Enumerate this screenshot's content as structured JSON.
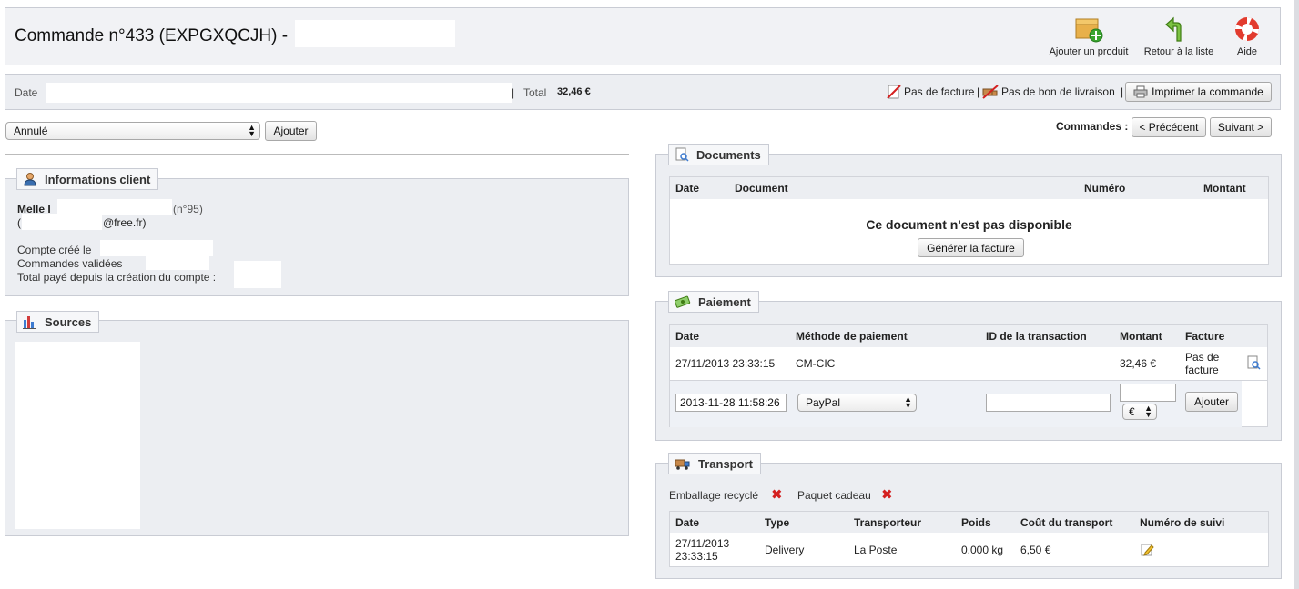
{
  "header": {
    "title": "Commande n°433 (EXPGXQCJH) -",
    "toolbar": {
      "add_product": "Ajouter un produit",
      "back_to_list": "Retour à la liste",
      "help": "Aide"
    }
  },
  "info_bar": {
    "date_label": "Date",
    "separator": "|",
    "total_label": "Total",
    "total_value": "32,46 €",
    "no_invoice": "Pas de facture",
    "pipe": "|",
    "no_delivery_slip": "Pas de bon de livraison",
    "print_order": "Imprimer la commande"
  },
  "status": {
    "selected": "Annulé",
    "add_button": "Ajouter"
  },
  "order_nav": {
    "label": "Commandes :",
    "previous": "< Précédent",
    "next": "Suivant >"
  },
  "client_info": {
    "legend": "Informations client",
    "name_prefix": "Melle I",
    "customer_id": "(n°95)",
    "email_open": "(",
    "email_suffix": "@free.fr)",
    "account_created": "Compte créé le",
    "validated_orders": "Commandes validées",
    "total_paid": "Total payé depuis la création du compte :"
  },
  "sources": {
    "legend": "Sources"
  },
  "documents": {
    "legend": "Documents",
    "columns": [
      "Date",
      "Document",
      "Numéro",
      "Montant"
    ],
    "empty_message": "Ce document n'est pas disponible",
    "generate_invoice": "Générer la facture"
  },
  "payment": {
    "legend": "Paiement",
    "columns": [
      "Date",
      "Méthode de paiement",
      "ID de la transaction",
      "Montant",
      "Facture"
    ],
    "rows": [
      {
        "date": "27/11/2013 23:33:15",
        "method": "CM-CIC",
        "transaction_id": "",
        "amount": "32,46 €",
        "invoice": "Pas de facture"
      }
    ],
    "new_row": {
      "date_value": "2013-11-28 11:58:26",
      "method_selected": "PayPal",
      "transaction_id_value": "",
      "amount_value": "",
      "currency_selected": "€",
      "add_button": "Ajouter"
    }
  },
  "transport": {
    "legend": "Transport",
    "recycled_packaging": "Emballage recyclé",
    "gift_wrap": "Paquet cadeau",
    "columns": [
      "Date",
      "Type",
      "Transporteur",
      "Poids",
      "Coût du transport",
      "Numéro de suivi"
    ],
    "rows": [
      {
        "date": "27/11/2013 23:33:15",
        "type": "Delivery",
        "carrier": "La Poste",
        "weight": "0.000 kg",
        "cost": "6,50 €"
      }
    ]
  }
}
